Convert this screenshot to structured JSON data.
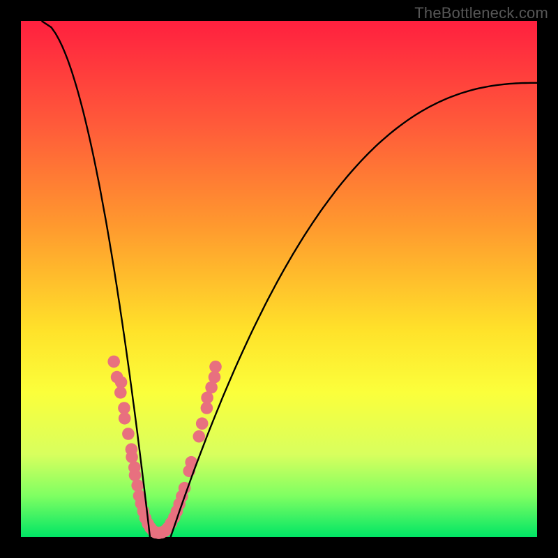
{
  "watermark": "TheBottleneck.com",
  "chart_data": {
    "type": "line",
    "title": "",
    "xlabel": "",
    "ylabel": "",
    "xlim": [
      0,
      100
    ],
    "ylim": [
      0,
      100
    ],
    "grid": false,
    "legend": false,
    "series": [
      {
        "name": "left-branch",
        "x_at_y100": 4,
        "x_at_y0": 25,
        "shape": "convex-right",
        "values_note": "curve descends from top-left to valley floor"
      },
      {
        "name": "right-branch",
        "x_at_y0": 29,
        "x_at_y88": 100,
        "shape": "concave-up",
        "values_note": "curve ascends from valley floor toward upper-right, flattening"
      }
    ],
    "scatter": {
      "name": "beads",
      "comment": "pink dot clusters along lower portions of both branches",
      "color": "#e8707f",
      "points_xy_pct": [
        [
          18.0,
          34.0
        ],
        [
          18.6,
          31.0
        ],
        [
          19.3,
          28.0
        ],
        [
          19.4,
          30.0
        ],
        [
          20.0,
          25.0
        ],
        [
          20.1,
          23.0
        ],
        [
          20.8,
          20.0
        ],
        [
          21.4,
          17.0
        ],
        [
          21.5,
          15.5
        ],
        [
          22.0,
          13.5
        ],
        [
          22.1,
          12.0
        ],
        [
          22.6,
          10.0
        ],
        [
          22.9,
          8.0
        ],
        [
          23.3,
          6.5
        ],
        [
          23.7,
          5.0
        ],
        [
          24.1,
          3.7
        ],
        [
          24.6,
          2.6
        ],
        [
          25.1,
          1.8
        ],
        [
          25.6,
          1.2
        ],
        [
          26.1,
          0.9
        ],
        [
          26.7,
          0.8
        ],
        [
          27.3,
          0.9
        ],
        [
          27.9,
          1.2
        ],
        [
          28.5,
          1.8
        ],
        [
          29.1,
          2.7
        ],
        [
          29.7,
          3.8
        ],
        [
          30.2,
          5.0
        ],
        [
          30.7,
          6.4
        ],
        [
          31.2,
          7.9
        ],
        [
          31.7,
          9.5
        ],
        [
          32.6,
          12.8
        ],
        [
          33.0,
          14.5
        ],
        [
          34.5,
          19.5
        ],
        [
          35.1,
          22.0
        ],
        [
          36.0,
          25.0
        ],
        [
          36.1,
          27.0
        ],
        [
          36.9,
          29.0
        ],
        [
          37.5,
          31.0
        ],
        [
          37.7,
          33.0
        ]
      ]
    },
    "gradient_stops": [
      {
        "pos": 0.0,
        "color": "#ff203f"
      },
      {
        "pos": 0.2,
        "color": "#ff5a3a"
      },
      {
        "pos": 0.4,
        "color": "#ff9a2e"
      },
      {
        "pos": 0.6,
        "color": "#ffe22a"
      },
      {
        "pos": 0.72,
        "color": "#fbff3b"
      },
      {
        "pos": 0.84,
        "color": "#d8ff5e"
      },
      {
        "pos": 0.92,
        "color": "#7fff62"
      },
      {
        "pos": 1.0,
        "color": "#00e565"
      }
    ]
  }
}
